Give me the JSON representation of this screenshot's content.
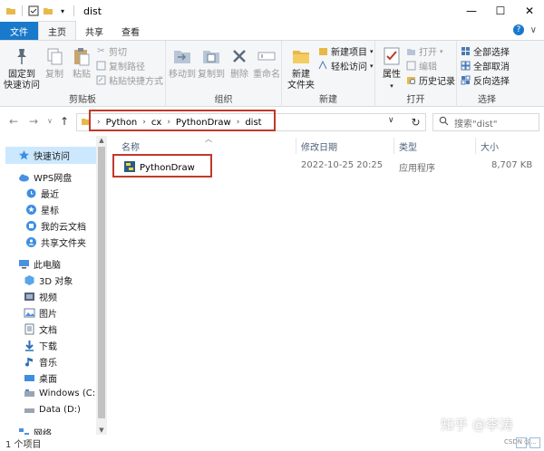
{
  "window": {
    "title": "dist",
    "minimize_label": "—",
    "maximize_label": "☐",
    "close_label": "✕"
  },
  "ribbon_tabs": [
    "文件",
    "主页",
    "共享",
    "查看"
  ],
  "ribbon": {
    "clipboard": {
      "label": "剪贴板",
      "pin": "固定到\n快速访问",
      "copy": "复制",
      "paste": "粘贴",
      "cut": "剪切",
      "copy_path": "复制路径",
      "paste_shortcut": "粘贴快捷方式"
    },
    "organize": {
      "label": "组织",
      "move_to": "移动到",
      "copy_to": "复制到",
      "delete": "删除",
      "rename": "重命名"
    },
    "new": {
      "label": "新建",
      "new_folder": "新建\n文件夹",
      "new_item": "新建项目",
      "easy_access": "轻松访问"
    },
    "open": {
      "label": "打开",
      "properties": "属性",
      "open": "打开",
      "edit": "编辑",
      "history": "历史记录"
    },
    "select": {
      "label": "选择",
      "select_all": "全部选择",
      "select_none": "全部取消",
      "invert": "反向选择"
    }
  },
  "address": {
    "crumbs": [
      "Python",
      "cx",
      "PythonDraw",
      "dist"
    ],
    "search_placeholder": "搜索\"dist\""
  },
  "navpane": {
    "items": [
      {
        "label": "快速访问",
        "icon": "star-icon"
      },
      {
        "label": "WPS网盘",
        "icon": "cloud-icon"
      },
      {
        "label": "最近",
        "icon": "clock-icon"
      },
      {
        "label": "星标",
        "icon": "star-badge-icon"
      },
      {
        "label": "我的云文档",
        "icon": "cloud-doc-icon"
      },
      {
        "label": "共享文件夹",
        "icon": "shared-folder-icon"
      },
      {
        "label": "此电脑",
        "icon": "pc-icon"
      },
      {
        "label": "3D 对象",
        "icon": "cube-icon"
      },
      {
        "label": "视频",
        "icon": "video-icon"
      },
      {
        "label": "图片",
        "icon": "picture-icon"
      },
      {
        "label": "文档",
        "icon": "document-icon"
      },
      {
        "label": "下载",
        "icon": "download-icon"
      },
      {
        "label": "音乐",
        "icon": "music-icon"
      },
      {
        "label": "桌面",
        "icon": "desktop-icon"
      },
      {
        "label": "Windows (C:)",
        "icon": "drive-c-icon"
      },
      {
        "label": "Data (D:)",
        "icon": "drive-d-icon"
      },
      {
        "label": "网络",
        "icon": "network-icon"
      }
    ]
  },
  "columns": {
    "name": "名称",
    "modified": "修改日期",
    "type": "类型",
    "size": "大小"
  },
  "files": [
    {
      "name": "PythonDraw",
      "modified": "2022-10-25 20:25",
      "type": "应用程序",
      "size": "8,707 KB"
    }
  ],
  "status": {
    "count": "1 个项目"
  },
  "watermark": {
    "text": "知乎 @李涛",
    "small": "CSDN @..."
  },
  "colors": {
    "accent": "#1979ca",
    "highlight_box": "#c0392b",
    "selected_bg": "#cce8ff"
  }
}
